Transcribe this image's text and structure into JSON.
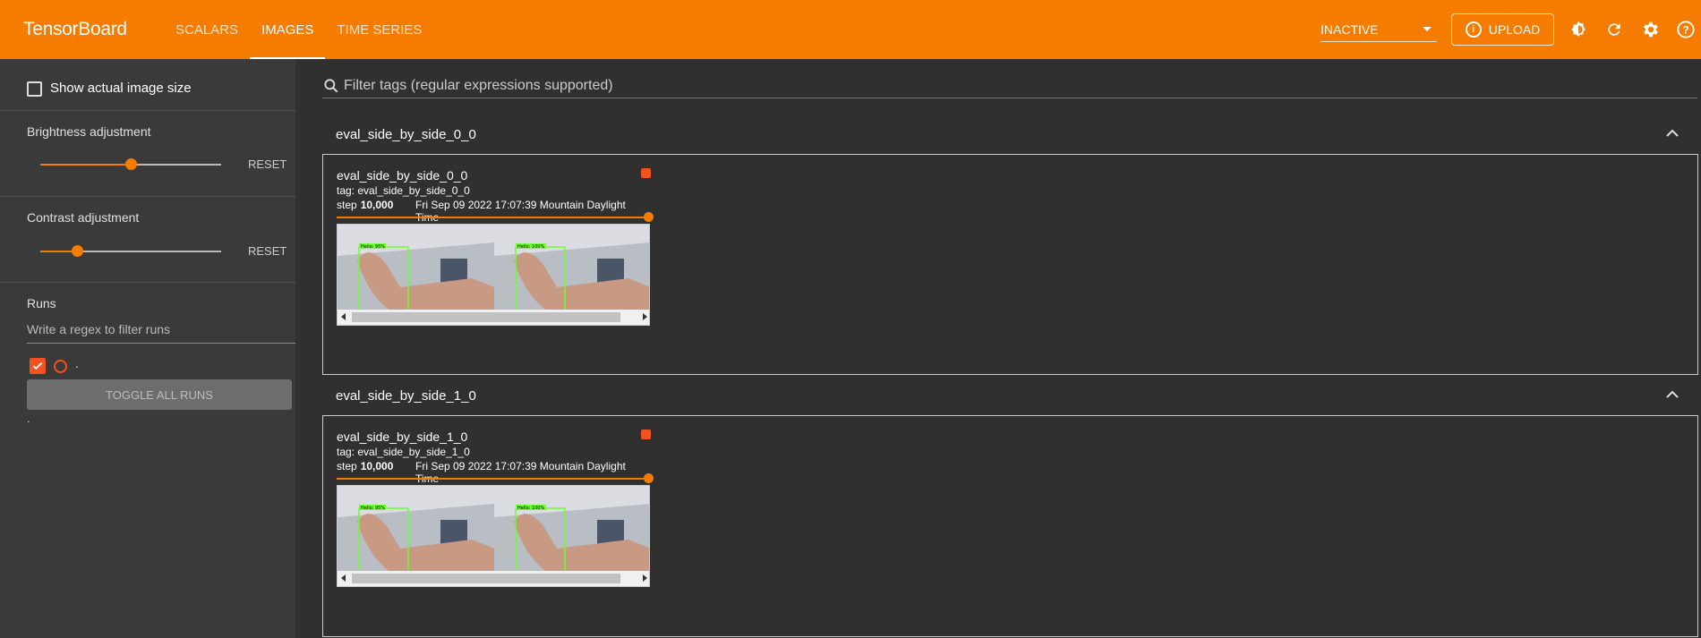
{
  "header": {
    "brand": "TensorBoard",
    "tabs": [
      {
        "label": "SCALARS"
      },
      {
        "label": "IMAGES"
      },
      {
        "label": "TIME SERIES"
      }
    ],
    "status_select": "INACTIVE",
    "upload_label": "UPLOAD",
    "accent_color": "#f57c00"
  },
  "sidebar": {
    "show_actual_size_label": "Show actual image size",
    "brightness": {
      "label": "Brightness adjustment",
      "reset": "RESET",
      "value_fraction": 0.5
    },
    "contrast": {
      "label": "Contrast adjustment",
      "reset": "RESET",
      "value_fraction": 0.2
    },
    "runs": {
      "label": "Runs",
      "filter_placeholder": "Write a regex to filter runs",
      "run_name": ".",
      "toggle_all": "TOGGLE ALL RUNS",
      "footer_text": "."
    }
  },
  "main": {
    "filter_placeholder": "Filter tags (regular expressions supported)",
    "groups": [
      {
        "name": "eval_side_by_side_0_0",
        "card": {
          "title": "eval_side_by_side_0_0",
          "tag": "tag: eval_side_by_side_0_0",
          "step_label": "step",
          "step_value": "10,000",
          "timestamp": "Fri Sep 09 2022 17:07:39 Mountain Daylight Time",
          "box_labels": [
            "Hello: 95%",
            "Hello: 100%"
          ]
        }
      },
      {
        "name": "eval_side_by_side_1_0",
        "card": {
          "title": "eval_side_by_side_1_0",
          "tag": "tag: eval_side_by_side_1_0",
          "step_label": "step",
          "step_value": "10,000",
          "timestamp": "Fri Sep 09 2022 17:07:39 Mountain Daylight Time",
          "box_labels": [
            "Hello: 95%",
            "Hello: 100%"
          ]
        }
      }
    ]
  }
}
